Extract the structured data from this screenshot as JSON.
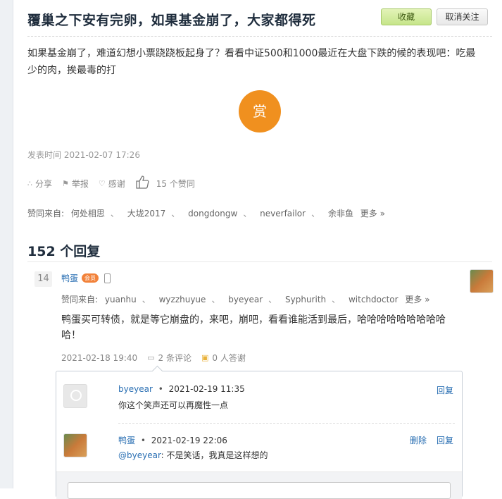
{
  "post": {
    "title": "覆巢之下安有完卵，如果基金崩了，大家都得死",
    "fav_label": "收藏",
    "unfollow_label": "取消关注",
    "body": "如果基金崩了，难道幻想小票跷跷板起身了？看看中证500和1000最近在大盘下跌的候的表现吧：吃最少的肉，挨最毒的打",
    "reward_label": "赏",
    "post_time": "发表时间 2021-02-07 17:26",
    "actions": {
      "share": "分享",
      "report": "举报",
      "thanks": "感谢",
      "likes": "15 个赞同"
    },
    "likes_from_label": "赞同来自:",
    "likes_from_users": [
      "何处相思",
      "大垅2017",
      "dongdongw",
      "neverfailor",
      "余非鱼"
    ],
    "more_label": "更多 »"
  },
  "replies": {
    "heading": "152 个回复",
    "items": [
      {
        "floor": "14",
        "user": "鸭蛋",
        "vip_badge": "会员",
        "likes_from_label": "赞同来自:",
        "likes_from_users": [
          "yuanhu",
          "wyzzhuyue",
          "byeyear",
          "Syphurith",
          "witchdoctor"
        ],
        "more_label": "更多 »",
        "text": "鸭蛋买可转债，就是等它崩盘的，来吧，崩吧，看看谁能活到最后，哈哈哈哈哈哈哈哈哈哈！",
        "time": "2021-02-18 19:40",
        "comments_label": "2 条评论",
        "answers_label": "0 人答谢",
        "comments": [
          {
            "user": "byeyear",
            "sep": "•",
            "time": "2021-02-19 11:35",
            "text": "你这个笑声还可以再魔性一点",
            "reply_label": "回复"
          },
          {
            "user": "鸭蛋",
            "sep": "•",
            "time": "2021-02-19 22:06",
            "mention": "@byeyear",
            "text": ": 不是笑话，我真是这样想的",
            "delete_label": "删除",
            "reply_label": "回复"
          }
        ]
      }
    ]
  },
  "colors": {
    "accent_link": "#2a6fb3",
    "reward": "#f0901f",
    "fav_button": "#c6e58a",
    "vip_badge": "#f2823a"
  },
  "icons": {
    "share": "share-icon",
    "report": "flag-icon",
    "thanks": "heart-icon",
    "like": "thumbs-up-icon",
    "comment": "comment-icon",
    "thanks_reply": "thanks-icon",
    "mobile": "mobile-icon"
  }
}
